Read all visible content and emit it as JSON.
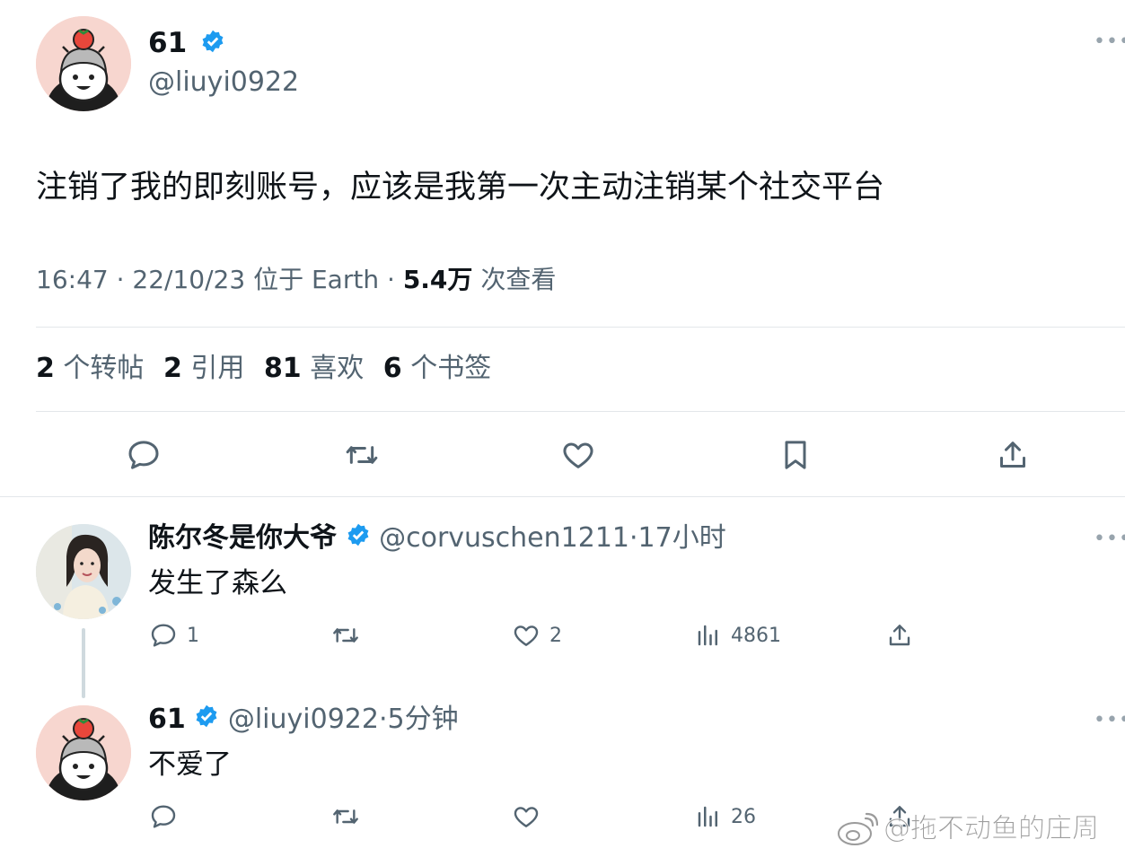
{
  "main_tweet": {
    "display_name": "61",
    "handle": "@liuyi0922",
    "text": "注销了我的即刻账号，应该是我第一次主动注销某个社交平台",
    "time": "16:47",
    "date": "22/10/23",
    "location": "位于 Earth",
    "views_count": "5.4万",
    "views_label": "次查看",
    "stats": {
      "retweets_count": "2",
      "retweets_label": "个转帖",
      "quotes_count": "2",
      "quotes_label": "引用",
      "likes_count": "81",
      "likes_label": "喜欢",
      "bookmarks_count": "6",
      "bookmarks_label": "个书签"
    }
  },
  "replies": [
    {
      "display_name": "陈尔冬是你大爷",
      "handle": "@corvuschen1211",
      "time": "17小时",
      "text": "发生了森么",
      "reply_count": "1",
      "like_count": "2",
      "view_count": "4861"
    },
    {
      "display_name": "61",
      "handle": "@liuyi0922",
      "time": "5分钟",
      "text": "不爱了",
      "reply_count": "",
      "like_count": "",
      "view_count": "26"
    }
  ],
  "separator": "·",
  "watermark": "@拖不动鱼的庄周",
  "colors": {
    "verified": "#1d9bf0",
    "muted": "#536471",
    "text": "#0f1419",
    "divider": "#e3e7ea"
  },
  "icons": [
    "reply-icon",
    "retweet-icon",
    "like-icon",
    "bookmark-icon",
    "share-icon",
    "views-icon",
    "more-icon",
    "verified-badge-icon",
    "weibo-logo-icon"
  ]
}
